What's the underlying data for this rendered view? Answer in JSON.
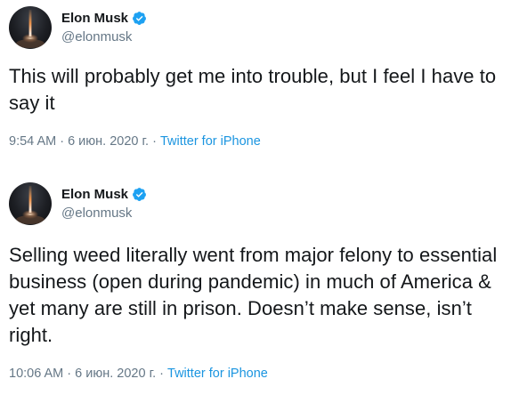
{
  "tweets": [
    {
      "author": {
        "display_name": "Elon Musk",
        "handle": "@elonmusk",
        "verified": true
      },
      "text": "This will probably get me into trouble, but I feel I have to say it",
      "timestamp": "9:54 AM · 6 июн. 2020 г.",
      "separator": " · ",
      "source": "Twitter for iPhone"
    },
    {
      "author": {
        "display_name": "Elon Musk",
        "handle": "@elonmusk",
        "verified": true
      },
      "text": "Selling weed literally went from major felony to essential business (open during pandemic) in much of America & yet many are still in prison. Doesn’t make sense, isn’t right.",
      "timestamp": "10:06 AM · 6 июн. 2020 г.",
      "separator": " · ",
      "source": "Twitter for iPhone"
    }
  ],
  "colors": {
    "verified_badge": "#1da1f2",
    "link": "#1b95e0",
    "secondary_text": "#657786",
    "primary_text": "#14171a"
  },
  "icons": {
    "avatar": "rocket-launch-avatar",
    "verified": "verified-badge-icon"
  }
}
